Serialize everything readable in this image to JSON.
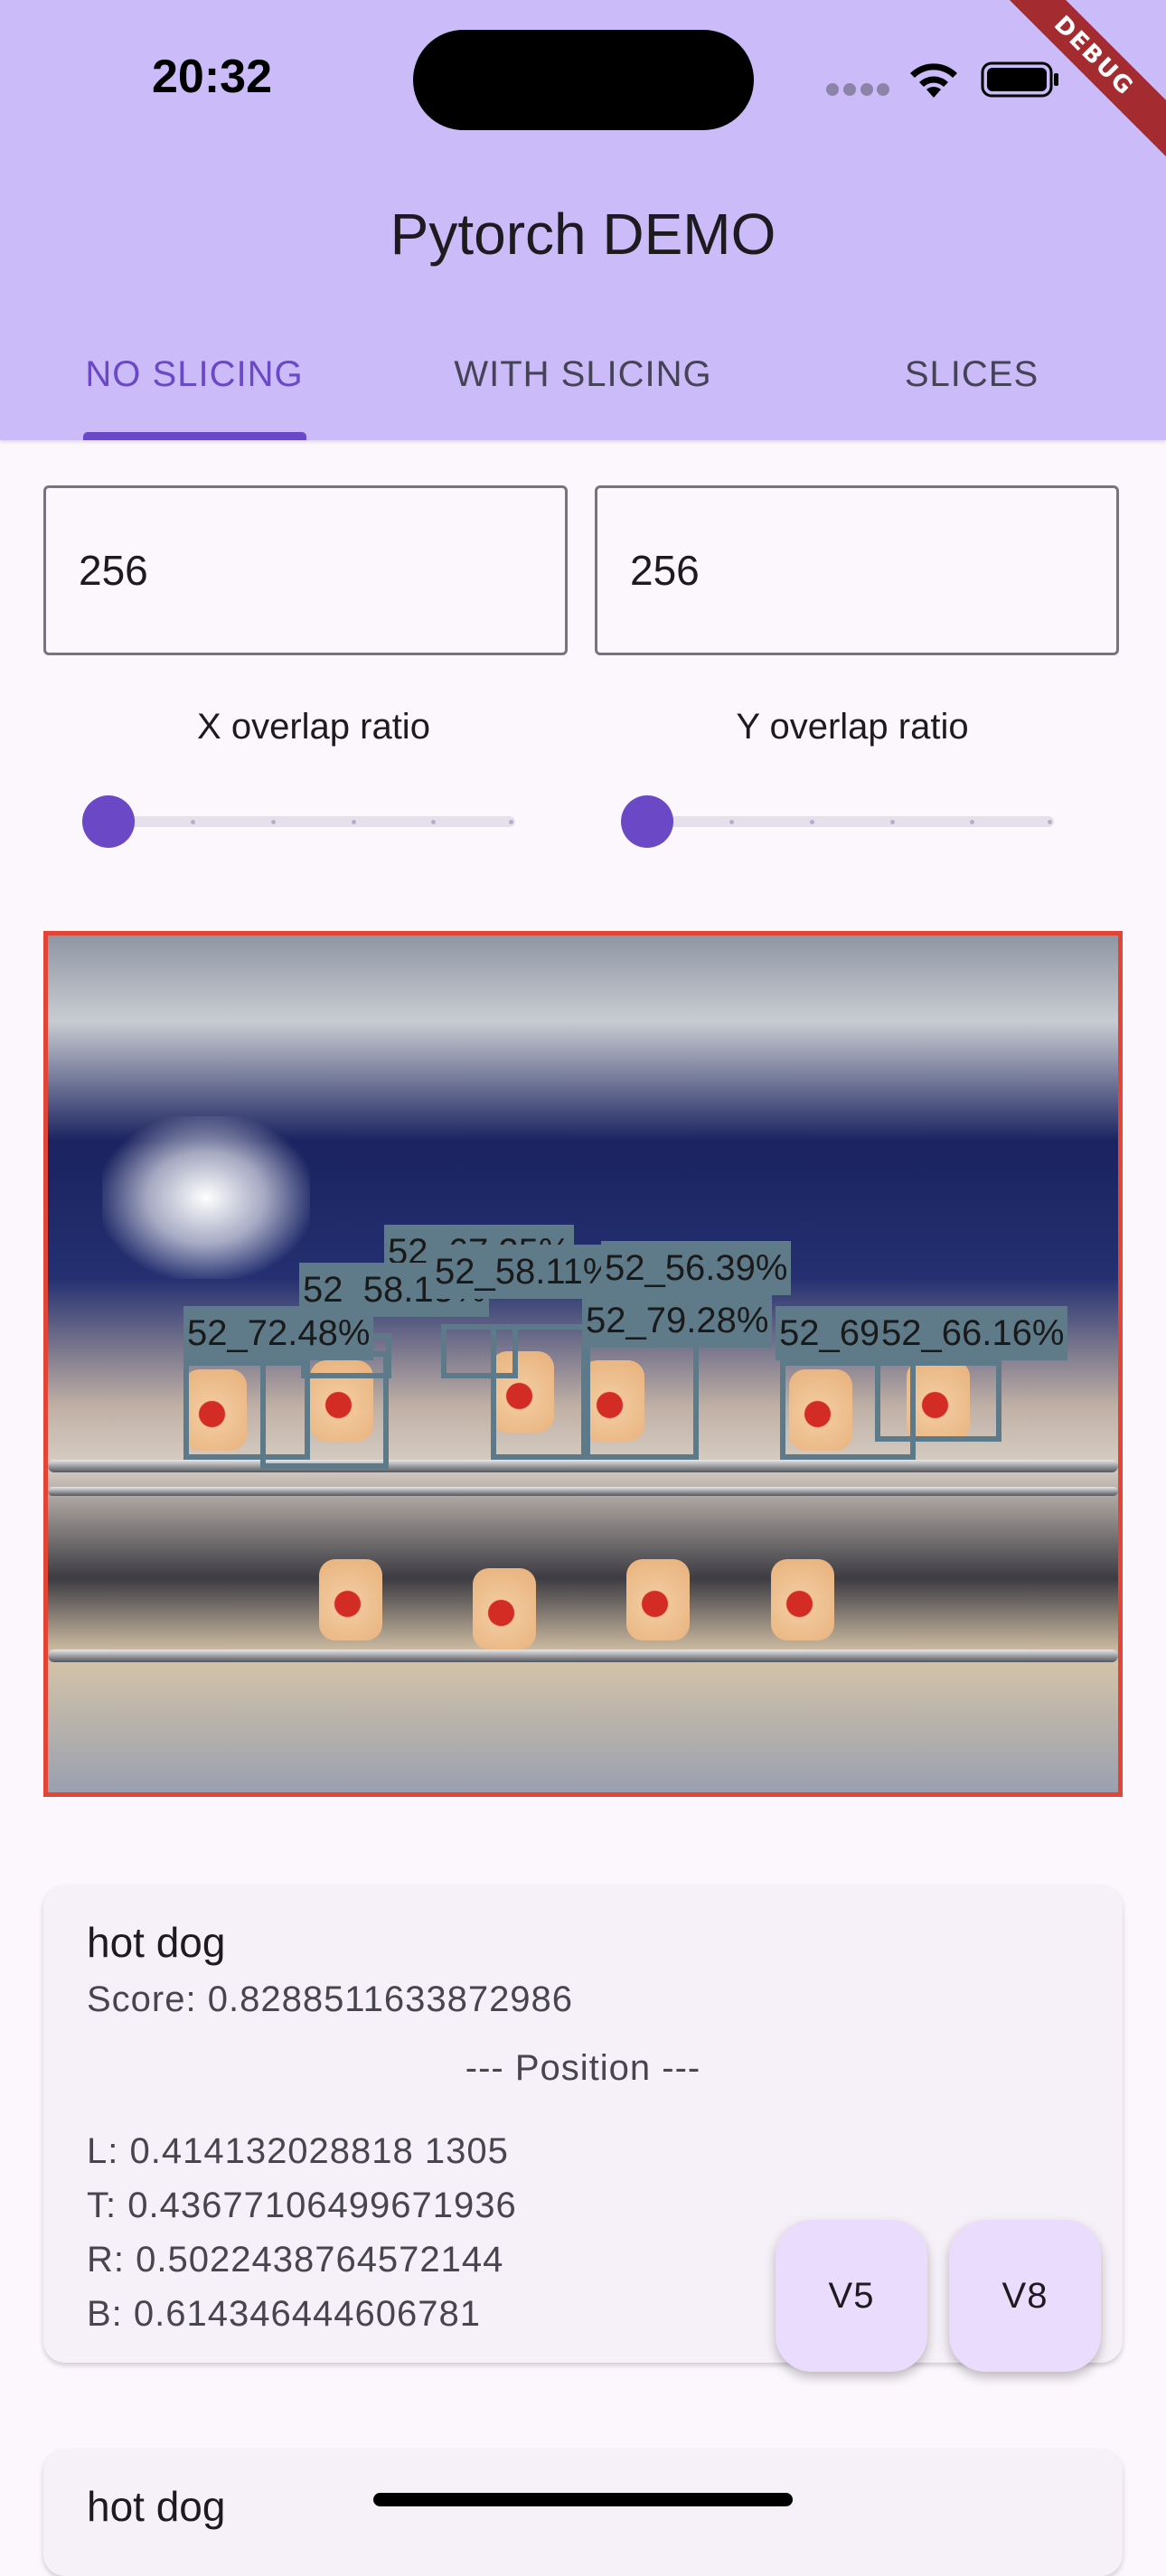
{
  "status_bar": {
    "time": "20:32"
  },
  "debug_banner": "DEBUG",
  "app_bar": {
    "title": "Pytorch DEMO"
  },
  "tabs": [
    {
      "label": "NO SLICING",
      "active": true
    },
    {
      "label": "WITH SLICING",
      "active": false
    },
    {
      "label": "SLICES",
      "active": false
    }
  ],
  "inputs": {
    "slice_width": "256",
    "slice_height": "256"
  },
  "sliders": {
    "x_label": "X overlap ratio",
    "y_label": "Y overlap ratio",
    "x_value": 0.0,
    "y_value": 0.0
  },
  "detections": [
    {
      "label": "52_72.48%"
    },
    {
      "label": "52_58.15%"
    },
    {
      "label": "52_67.25%"
    },
    {
      "label": "52_58.11%"
    },
    {
      "label": "52_56.39%"
    },
    {
      "label": "52_79.28%"
    },
    {
      "label": "52_69.01%"
    },
    {
      "label": "52_66.16%"
    }
  ],
  "results": [
    {
      "name": "hot dog",
      "score": "Score: 0.8288511633872986",
      "position_header": "--- Position ---",
      "left": "L: 0.414132028818 1305",
      "top": "T: 0.43677106499671936",
      "right": "R: 0.5022438764572144",
      "bottom": "B: 0.614346444606781"
    },
    {
      "name": "hot dog"
    }
  ],
  "fabs": {
    "v5": "V5",
    "v8": "V8"
  },
  "colors": {
    "accent": "#6a48c6",
    "appbar": "#cbbbf8",
    "image_border": "#e34435",
    "box": "#5f7b8a"
  }
}
